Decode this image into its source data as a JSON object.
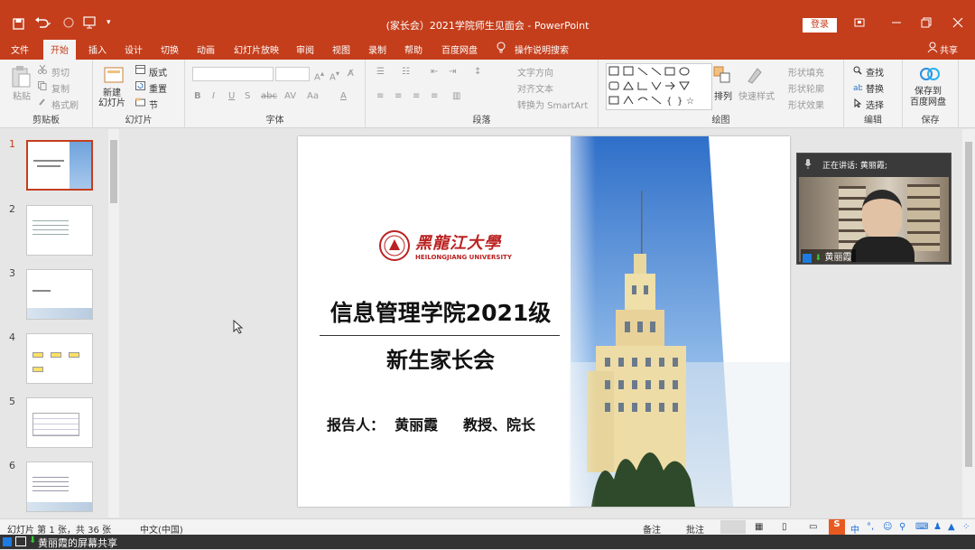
{
  "window": {
    "title": "(家长会）2021学院师生见面会 - PowerPoint",
    "login_label": "登录",
    "share_label": "共享"
  },
  "menu": {
    "tabs": [
      "文件",
      "开始",
      "插入",
      "设计",
      "切换",
      "动画",
      "幻灯片放映",
      "审阅",
      "视图",
      "录制",
      "帮助",
      "百度网盘"
    ],
    "active_tab": "开始",
    "tell_me": "操作说明搜索"
  },
  "ribbon": {
    "clipboard": {
      "paste": "粘贴",
      "cut": "剪切",
      "copy": "复制",
      "format_painter": "格式刷",
      "label": "剪贴板"
    },
    "slides": {
      "new_slide": "新建\n幻灯片",
      "layout": "版式",
      "reset": "重置",
      "section": "节",
      "label": "幻灯片"
    },
    "font": {
      "label": "字体"
    },
    "paragraph": {
      "text_direction": "文字方向",
      "align_text": "对齐文本",
      "smartart": "转换为 SmartArt",
      "label": "段落"
    },
    "drawing": {
      "arrange": "排列",
      "quick_styles": "快速样式",
      "shape_fill": "形状填充",
      "shape_outline": "形状轮廓",
      "shape_effects": "形状效果",
      "label": "绘图"
    },
    "editing": {
      "find": "查找",
      "replace": "替换",
      "select": "选择",
      "label": "编辑"
    },
    "save": {
      "save_to": "保存到\n百度网盘",
      "label": "保存"
    }
  },
  "thumbnails": {
    "numbers": [
      "1",
      "2",
      "3",
      "4",
      "5",
      "6"
    ],
    "selected": "1"
  },
  "slide": {
    "logo_text": "黑龍江大學",
    "logo_sub": "HEILONGJIANG UNIVERSITY",
    "title_line1": "信息管理学院2021级",
    "title_line2": "新生家长会",
    "presenter": "报告人：  黄丽霞     教授、院长"
  },
  "video": {
    "speaking": "正在讲话: 黄丽霞;",
    "name": "黄丽霞"
  },
  "status": {
    "slide_info": "幻灯片 第 1 张，共 36 张",
    "language": "中文(中国)",
    "notes": "备注",
    "comments": "批注"
  },
  "bottom": {
    "share_text": "黄丽霞的屏幕共享"
  },
  "colors": {
    "accent": "#c43e1c",
    "ribbon": "#f3f3f3",
    "slide_bg": "#ffffff"
  },
  "icons": [
    "save-icon",
    "undo-icon",
    "redo-icon",
    "start-from-beginning-icon",
    "customize-icon",
    "restore-icon",
    "minimize-icon",
    "close-icon",
    "lightbulb-icon",
    "user-icon",
    "paste-icon",
    "scissors-icon",
    "copy-icon",
    "brush-icon",
    "new-slide-icon",
    "layout-icon",
    "reset-icon",
    "section-icon",
    "shapes-gallery",
    "arrange-icon",
    "quick-styles-icon",
    "find-icon",
    "replace-icon",
    "select-icon",
    "baidu-cloud-icon",
    "microphone-icon",
    "person-icon"
  ]
}
